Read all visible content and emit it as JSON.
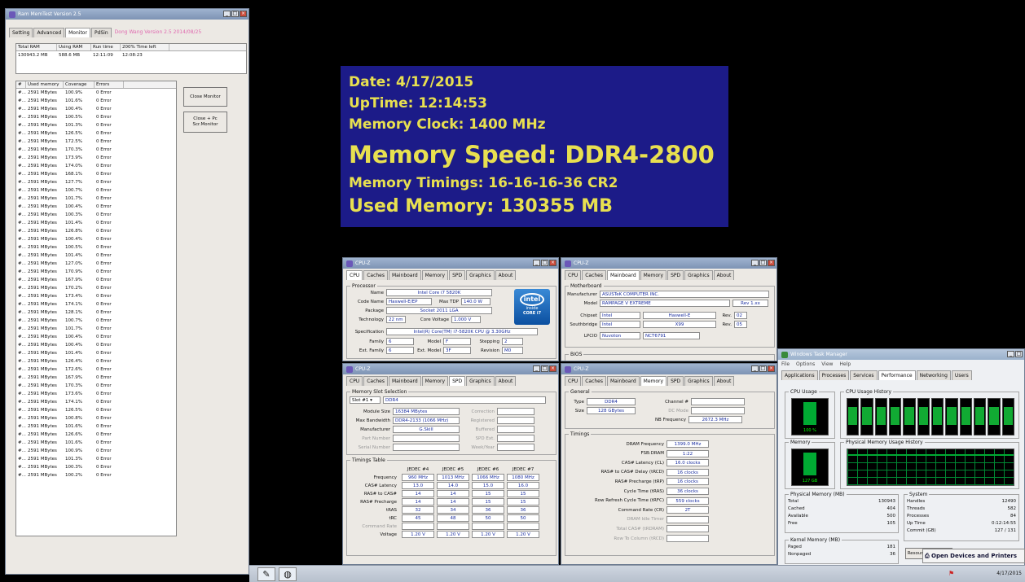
{
  "memtest": {
    "title": "Ram MemTest Version 2.5",
    "tabs": [
      "Setting",
      "Advanced",
      "Monitor",
      "PdSin"
    ],
    "promo": "Dong Wang Version 2.5 2014/08/25",
    "summary_headers": [
      "Total RAM",
      "Using RAM",
      "Run time",
      "200% Time left"
    ],
    "summary_values": [
      "130943.2 MB",
      "588.6 MB",
      "12:11:09",
      "12:08:23"
    ],
    "list_headers": [
      "#",
      "Used memory",
      "Coverage",
      "Errors"
    ],
    "rows": [
      [
        "#...",
        "2591 MBytes",
        "100.9%",
        "0 Error"
      ],
      [
        "#...",
        "2591 MBytes",
        "101.6%",
        "0 Error"
      ],
      [
        "#...",
        "2591 MBytes",
        "100.4%",
        "0 Error"
      ],
      [
        "#...",
        "2591 MBytes",
        "100.5%",
        "0 Error"
      ],
      [
        "#...",
        "2591 MBytes",
        "101.3%",
        "0 Error"
      ],
      [
        "#...",
        "2591 MBytes",
        "126.5%",
        "0 Error"
      ],
      [
        "#...",
        "2591 MBytes",
        "172.5%",
        "0 Error"
      ],
      [
        "#...",
        "2591 MBytes",
        "170.3%",
        "0 Error"
      ],
      [
        "#...",
        "2591 MBytes",
        "173.9%",
        "0 Error"
      ],
      [
        "#...",
        "2591 MBytes",
        "174.0%",
        "0 Error"
      ],
      [
        "#...",
        "2591 MBytes",
        "168.1%",
        "0 Error"
      ],
      [
        "#...",
        "2591 MBytes",
        "127.7%",
        "0 Error"
      ],
      [
        "#...",
        "2591 MBytes",
        "100.7%",
        "0 Error"
      ],
      [
        "#...",
        "2591 MBytes",
        "101.7%",
        "0 Error"
      ],
      [
        "#...",
        "2591 MBytes",
        "100.4%",
        "0 Error"
      ],
      [
        "#...",
        "2591 MBytes",
        "100.3%",
        "0 Error"
      ],
      [
        "#...",
        "2591 MBytes",
        "101.4%",
        "0 Error"
      ],
      [
        "#...",
        "2591 MBytes",
        "126.8%",
        "0 Error"
      ],
      [
        "#...",
        "2591 MBytes",
        "100.4%",
        "0 Error"
      ],
      [
        "#...",
        "2591 MBytes",
        "100.5%",
        "0 Error"
      ],
      [
        "#...",
        "2591 MBytes",
        "101.4%",
        "0 Error"
      ],
      [
        "#...",
        "2591 MBytes",
        "127.0%",
        "0 Error"
      ],
      [
        "#...",
        "2591 MBytes",
        "170.9%",
        "0 Error"
      ],
      [
        "#...",
        "2591 MBytes",
        "167.9%",
        "0 Error"
      ],
      [
        "#...",
        "2591 MBytes",
        "170.2%",
        "0 Error"
      ],
      [
        "#...",
        "2591 MBytes",
        "173.4%",
        "0 Error"
      ],
      [
        "#...",
        "2591 MBytes",
        "174.1%",
        "0 Error"
      ],
      [
        "#...",
        "2591 MBytes",
        "128.1%",
        "0 Error"
      ],
      [
        "#...",
        "2591 MBytes",
        "100.7%",
        "0 Error"
      ],
      [
        "#...",
        "2591 MBytes",
        "101.7%",
        "0 Error"
      ],
      [
        "#...",
        "2591 MBytes",
        "100.4%",
        "0 Error"
      ],
      [
        "#...",
        "2591 MBytes",
        "100.4%",
        "0 Error"
      ],
      [
        "#...",
        "2591 MBytes",
        "101.4%",
        "0 Error"
      ],
      [
        "#...",
        "2591 MBytes",
        "126.4%",
        "0 Error"
      ],
      [
        "#...",
        "2591 MBytes",
        "172.6%",
        "0 Error"
      ],
      [
        "#...",
        "2591 MBytes",
        "167.9%",
        "0 Error"
      ],
      [
        "#...",
        "2591 MBytes",
        "170.3%",
        "0 Error"
      ],
      [
        "#...",
        "2591 MBytes",
        "173.6%",
        "0 Error"
      ],
      [
        "#...",
        "2591 MBytes",
        "174.1%",
        "0 Error"
      ],
      [
        "#...",
        "2591 MBytes",
        "126.5%",
        "0 Error"
      ],
      [
        "#...",
        "2591 MBytes",
        "100.8%",
        "0 Error"
      ],
      [
        "#...",
        "2591 MBytes",
        "101.6%",
        "0 Error"
      ],
      [
        "#...",
        "2591 MBytes",
        "126.6%",
        "0 Error"
      ],
      [
        "#...",
        "2591 MBytes",
        "101.6%",
        "0 Error"
      ],
      [
        "#...",
        "2591 MBytes",
        "100.9%",
        "0 Error"
      ],
      [
        "#...",
        "2591 MBytes",
        "101.3%",
        "0 Error"
      ],
      [
        "#...",
        "2591 MBytes",
        "100.3%",
        "0 Error"
      ],
      [
        "#...",
        "2591 MBytes",
        "100.2%",
        "0 Error"
      ]
    ],
    "close_monitor": "Close Monitor",
    "close_pc": "Close + Pc Scr.Monitor"
  },
  "banner": {
    "date": "Date: 4/17/2015",
    "uptime": "UpTime: 12:14:53",
    "clock": "Memory Clock: 1400 MHz",
    "speed": "Memory Speed: DDR4-2800",
    "timings": "Memory Timings: 16-16-16-36 CR2",
    "used": "Used Memory: 130355 MB",
    "bg": "#1c1b88",
    "fg": "#e8e050"
  },
  "cpuz_tabs": [
    "CPU",
    "Caches",
    "Mainboard",
    "Memory",
    "SPD",
    "Graphics",
    "About"
  ],
  "cpuz_title": "CPU-Z",
  "cpu": {
    "group": "Processor",
    "name_lbl": "Name",
    "name": "Intel Core i7 5820K",
    "code_lbl": "Code Name",
    "code": "Haswell-E/EP",
    "tdp_lbl": "Max TDP",
    "tdp": "140.0 W",
    "pkg_lbl": "Package",
    "pkg": "Socket 2011 LGA",
    "tech_lbl": "Technology",
    "tech": "22 nm",
    "volt_lbl": "Core Voltage",
    "volt": "1.000 V",
    "spec_lbl": "Specification",
    "spec": "Intel(R) Core(TM) i7-5820K CPU @ 3.30GHz",
    "fam_lbl": "Family",
    "fam": "6",
    "model_lbl": "Model",
    "model": "F",
    "step_lbl": "Stepping",
    "step": "2",
    "efam_lbl": "Ext. Family",
    "efam": "6",
    "emodel_lbl": "Ext. Model",
    "emodel": "3F",
    "rev_lbl": "Revision",
    "rev": "M0",
    "logo_brand": "intel",
    "logo_inside": "inside",
    "logo_line": "CORE i7"
  },
  "mb": {
    "group": "Motherboard",
    "manu_lbl": "Manufacturer",
    "manu": "ASUSTeK COMPUTER INC.",
    "model_lbl": "Model",
    "model": "RAMPAGE V EXTREME",
    "rev": "Rev 1.xx",
    "chip_lbl": "Chipset",
    "chip": "Intel",
    "chip2": "Haswell-E",
    "chip_rev_lbl": "Rev.",
    "chip_rev": "02",
    "south_lbl": "Southbridge",
    "south": "Intel",
    "south2": "X99",
    "south_rev": "05",
    "lpc_lbl": "LPCIO",
    "lpc": "Nuvoton",
    "lpc2": "NCT6791",
    "bios": "BIOS"
  },
  "spd": {
    "group": "Memory Slot Selection",
    "slot": "Slot #1",
    "type": "DDR4",
    "msize_lbl": "Module Size",
    "msize": "16384 MBytes",
    "corr": "Correction",
    "bw_lbl": "Max Bandwidth",
    "bw": "DDR4-2133 (1066 MHz)",
    "reg": "Registered",
    "manu_lbl": "Manufacturer",
    "manu": "G.Skill",
    "buf": "Buffered",
    "part_lbl": "Part Number",
    "spd_ext": "SPD Ext.",
    "serial_lbl": "Serial Number",
    "week": "Week/Year",
    "tt_group": "Timings Table",
    "cols": [
      "JEDEC #4",
      "JEDEC #5",
      "JEDEC #6",
      "JEDEC #7"
    ],
    "rows": [
      {
        "l": "Frequency",
        "v": [
          "960 MHz",
          "1013 MHz",
          "1066 MHz",
          "1080 MHz"
        ]
      },
      {
        "l": "CAS# Latency",
        "v": [
          "13.0",
          "14.0",
          "15.0",
          "16.0"
        ]
      },
      {
        "l": "RAS# to CAS#",
        "v": [
          "14",
          "14",
          "15",
          "15"
        ]
      },
      {
        "l": "RAS# Precharge",
        "v": [
          "14",
          "14",
          "15",
          "15"
        ]
      },
      {
        "l": "tRAS",
        "v": [
          "32",
          "34",
          "36",
          "36"
        ]
      },
      {
        "l": "tRC",
        "v": [
          "45",
          "48",
          "50",
          "50"
        ]
      },
      {
        "l": "Command Rate",
        "v": [
          "",
          "",
          "",
          ""
        ]
      },
      {
        "l": "Voltage",
        "v": [
          "1.20 V",
          "1.20 V",
          "1.20 V",
          "1.20 V"
        ]
      }
    ]
  },
  "mem": {
    "general": "General",
    "type_lbl": "Type",
    "type": "DDR4",
    "chan_lbl": "Channel #",
    "chan": "",
    "size_lbl": "Size",
    "size": "128 GBytes",
    "dc": "DC Mode",
    "nb_lbl": "NB Frequency",
    "nb": "2672.3 MHz",
    "timings": "Timings",
    "rows": [
      {
        "l": "DRAM Frequency",
        "v": "1399.0 MHz"
      },
      {
        "l": "FSB:DRAM",
        "v": "1:22"
      },
      {
        "l": "CAS# Latency (CL)",
        "v": "16.0 clocks"
      },
      {
        "l": "RAS# to CAS# Delay (tRCD)",
        "v": "16 clocks"
      },
      {
        "l": "RAS# Precharge (tRP)",
        "v": "16 clocks"
      },
      {
        "l": "Cycle Time (tRAS)",
        "v": "36 clocks"
      },
      {
        "l": "Row Refresh Cycle Time (tRFC)",
        "v": "559 clocks"
      },
      {
        "l": "Command Rate (CR)",
        "v": "2T"
      },
      {
        "l": "DRAM Idle Timer",
        "v": ""
      },
      {
        "l": "Total CAS# (tRDRAM)",
        "v": ""
      },
      {
        "l": "Row To Column (tRCD)",
        "v": ""
      }
    ]
  },
  "tm": {
    "title": "Windows Task Manager",
    "menu": [
      "File",
      "Options",
      "View",
      "Help"
    ],
    "tabs": [
      "Applications",
      "Processes",
      "Services",
      "Performance",
      "Networking",
      "Users"
    ],
    "cpu_usage": "CPU Usage",
    "cpu_hist": "CPU Usage History",
    "cpu_val": "100 %",
    "mem": "Memory",
    "mem_hist": "Physical Memory Usage History",
    "mem_val": "127 GB",
    "phys": "Physical Memory (MB)",
    "phys_rows": [
      [
        "Total",
        "130943"
      ],
      [
        "Cached",
        "404"
      ],
      [
        "Available",
        "500"
      ],
      [
        "Free",
        "105"
      ]
    ],
    "sys": "System",
    "sys_rows": [
      [
        "Handles",
        "12490"
      ],
      [
        "Threads",
        "582"
      ],
      [
        "Processes",
        "84"
      ],
      [
        "Up Time",
        "0:12:14:55"
      ],
      [
        "Commit (GB)",
        "127 / 131"
      ]
    ],
    "kernel": "Kernel Memory (MB)",
    "kern_rows": [
      [
        "Paged",
        "181"
      ],
      [
        "Nonpaged",
        "36"
      ]
    ],
    "resmon": "Resource Monitor..."
  },
  "tooltip": "Open Devices and Printers",
  "taskbar": {
    "clock": "4/17/2015"
  }
}
